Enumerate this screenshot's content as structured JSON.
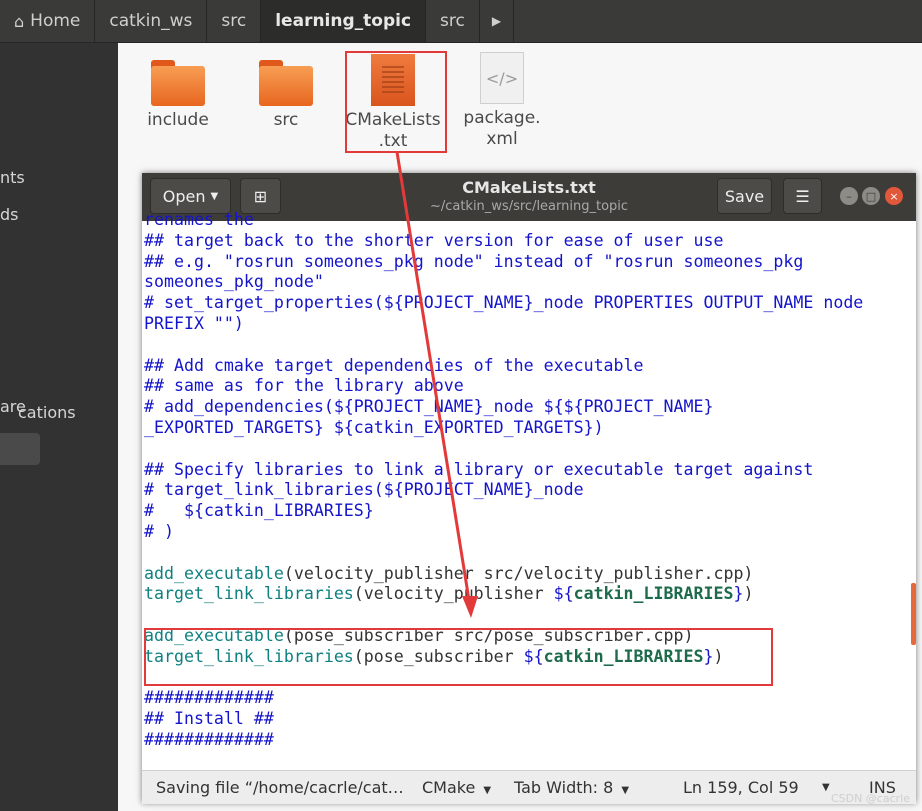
{
  "pathbar": {
    "crumbs": [
      "Home",
      "catkin_ws",
      "src",
      "learning_topic",
      "src"
    ],
    "active_index": 3
  },
  "sidebar": {
    "fragments": [
      "nts",
      "ds",
      "are",
      "cations"
    ]
  },
  "files": [
    {
      "name": "include",
      "icon": "folder-icon"
    },
    {
      "name": "src",
      "icon": "folder-icon"
    },
    {
      "name": "CMakeLists\n.txt",
      "icon": "text-file-icon"
    },
    {
      "name": "package.\nxml",
      "icon": "xml-file-icon"
    }
  ],
  "editor": {
    "open_label": "Open",
    "title": "CMakeLists.txt",
    "subtitle": "~/catkin_ws/src/learning_topic",
    "save_label": "Save",
    "code_lines": [
      {
        "t": "renames the",
        "k": "c"
      },
      {
        "t": "## target back to the shorter version for ease of user use",
        "k": "c"
      },
      {
        "t": "## e.g. \"rosrun someones_pkg node\" instead of \"rosrun someones_pkg",
        "k": "c"
      },
      {
        "t": "someones_pkg_node\"",
        "k": "c"
      },
      {
        "t": "# set_target_properties(${PROJECT_NAME}_node PROPERTIES OUTPUT_NAME node",
        "k": "c"
      },
      {
        "t": "PREFIX \"\")",
        "k": "c"
      },
      {
        "t": "",
        "k": "c"
      },
      {
        "t": "## Add cmake target dependencies of the executable",
        "k": "c"
      },
      {
        "t": "## same as for the library above",
        "k": "c"
      },
      {
        "t": "# add_dependencies(${PROJECT_NAME}_node ${${PROJECT_NAME}",
        "k": "c"
      },
      {
        "t": "_EXPORTED_TARGETS} ${catkin_EXPORTED_TARGETS})",
        "k": "c"
      },
      {
        "t": "",
        "k": "c"
      },
      {
        "t": "## Specify libraries to link a library or executable target against",
        "k": "c"
      },
      {
        "t": "# target_link_libraries(${PROJECT_NAME}_node",
        "k": "c"
      },
      {
        "t": "#   ${catkin_LIBRARIES}",
        "k": "c"
      },
      {
        "t": "# )",
        "k": "c"
      },
      {
        "t": "",
        "k": "c"
      },
      {
        "fn": "add_executable",
        "args": "(velocity_publisher src/velocity_publisher.cpp)"
      },
      {
        "fn": "target_link_libraries",
        "args": "(velocity_publisher ",
        "var": "catkin_LIBRARIES",
        "end": ")"
      },
      {
        "t": "",
        "k": "c"
      },
      {
        "fn": "add_executable",
        "args": "(pose_subscriber src/pose_subscriber.cpp)"
      },
      {
        "fn": "target_link_libraries",
        "args": "(pose_subscriber ",
        "var": "catkin_LIBRARIES",
        "end": ")"
      },
      {
        "t": "",
        "k": "c"
      },
      {
        "t": "#############",
        "k": "c"
      },
      {
        "t": "## Install ##",
        "k": "c"
      },
      {
        "t": "#############",
        "k": "c"
      }
    ],
    "status": {
      "message": "Saving file “/home/cacrle/cat…",
      "language": "CMake",
      "tab_width": "Tab Width: 8",
      "position": "Ln 159, Col 59",
      "mode": "INS"
    }
  },
  "watermark": "CSDN @cacrle",
  "colors": {
    "comment": "#1414cc",
    "function": "#0f8080",
    "highlight_box": "#e23a3a"
  }
}
